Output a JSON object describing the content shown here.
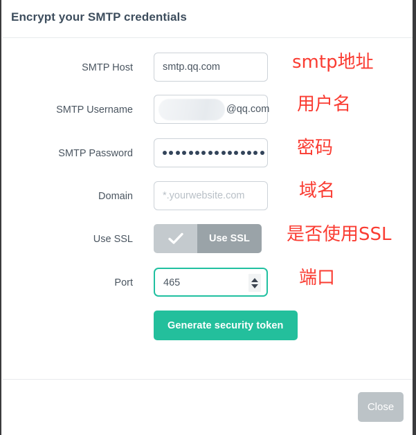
{
  "modal": {
    "title": "Encrypt your SMTP credentials",
    "close_label": "Close",
    "generate_label": "Generate security token"
  },
  "colors": {
    "accent": "#23bf9c",
    "focus_border": "#20c0a0",
    "annotation": "#fa3c32",
    "title": "#3d4d5d",
    "label": "#4a5560",
    "toggle_on": "#c4cace",
    "toggle_label": "#9aa3a8",
    "close_button": "#bcc3c7"
  },
  "form": {
    "rows": [
      {
        "label": "SMTP Host",
        "type": "text",
        "value": "smtp.qq.com",
        "placeholder": "",
        "annotation": "smtp地址"
      },
      {
        "label": "SMTP Username",
        "type": "redacted",
        "value": "",
        "suffix": "@qq.com",
        "placeholder": "",
        "annotation": "用户名"
      },
      {
        "label": "SMTP Password",
        "type": "password",
        "value": "",
        "dot_count": 16,
        "placeholder": "",
        "annotation": "密码"
      },
      {
        "label": "Domain",
        "type": "text",
        "value": "",
        "placeholder": "*.yourwebsite.com",
        "annotation": "域名"
      },
      {
        "label": "Use SSL",
        "type": "toggle",
        "toggle_label": "Use SSL",
        "checked": true,
        "annotation": "是否使用SSL"
      },
      {
        "label": "Port",
        "type": "number",
        "value": "465",
        "placeholder": "",
        "focused": true,
        "annotation": "端口"
      }
    ]
  }
}
